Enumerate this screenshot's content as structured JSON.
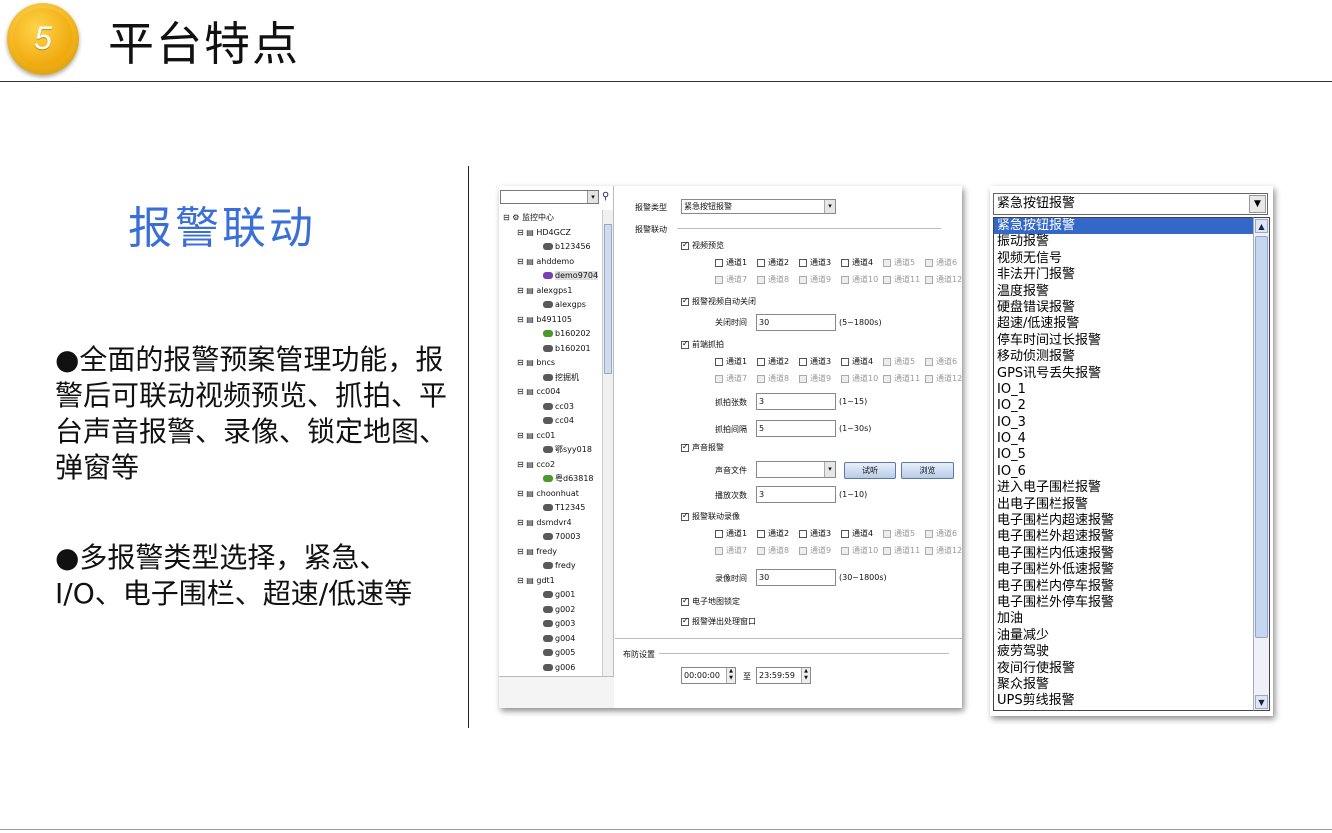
{
  "header": {
    "badge_number": "5",
    "title": "平台特点"
  },
  "section_title": "报警联动",
  "bullets": [
    "●全面的报警预案管理功能，报警后可联动视频预览、抓拍、平台声音报警、录像、锁定地图、弹窗等",
    "●多报警类型选择，紧急、I/O、电子围栏、超速/低速等"
  ],
  "tree": {
    "items": [
      {
        "label": "监控中心",
        "level": 0
      },
      {
        "label": "HD4GCZ",
        "level": 1
      },
      {
        "label": "b123456",
        "level": 2
      },
      {
        "label": "ahddemo",
        "level": 1
      },
      {
        "label": "demo9704",
        "level": 2
      },
      {
        "label": "alexgps1",
        "level": 1
      },
      {
        "label": "alexgps",
        "level": 2
      },
      {
        "label": "b491105",
        "level": 1
      },
      {
        "label": "b160202",
        "level": 2
      },
      {
        "label": "b160201",
        "level": 2
      },
      {
        "label": "bncs",
        "level": 1
      },
      {
        "label": "挖掘机",
        "level": 2
      },
      {
        "label": "cc004",
        "level": 1
      },
      {
        "label": "cc03",
        "level": 2
      },
      {
        "label": "cc04",
        "level": 2
      },
      {
        "label": "cc01",
        "level": 1
      },
      {
        "label": "鄂syy018",
        "level": 2
      },
      {
        "label": "cco2",
        "level": 1
      },
      {
        "label": "粤d63818",
        "level": 2
      },
      {
        "label": "choonhuat",
        "level": 1
      },
      {
        "label": "T12345",
        "level": 2
      },
      {
        "label": "dsmdvr4",
        "level": 1
      },
      {
        "label": "70003",
        "level": 2
      },
      {
        "label": "fredy",
        "level": 1
      },
      {
        "label": "fredy",
        "level": 2
      },
      {
        "label": "gdt1",
        "level": 1
      },
      {
        "label": "g001",
        "level": 2
      },
      {
        "label": "g002",
        "level": 2
      },
      {
        "label": "g003",
        "level": 2
      },
      {
        "label": "g004",
        "level": 2
      },
      {
        "label": "g005",
        "level": 2
      },
      {
        "label": "g006",
        "level": 2
      }
    ]
  },
  "form": {
    "alarm_type_label": "报警类型",
    "alarm_type_value": "紧急按钮报警",
    "alarm_link_label": "报警联动",
    "video_preview": "视频预览",
    "channels_row1": [
      "通道1",
      "通道2",
      "通道3",
      "通道4",
      "通道5",
      "通道6"
    ],
    "channels_row2": [
      "通道7",
      "通道8",
      "通道9",
      "通道10",
      "通道11",
      "通道12"
    ],
    "auto_close": "报警视频自动关闭",
    "close_time_label": "关闭时间",
    "close_time_value": "30",
    "close_time_range": "(5~1800s)",
    "front_capture": "前端抓拍",
    "capture_count_label": "抓拍张数",
    "capture_count_value": "3",
    "capture_count_range": "(1~15)",
    "capture_interval_label": "抓拍间隔",
    "capture_interval_value": "5",
    "capture_interval_range": "(1~30s)",
    "sound_alarm": "声音报警",
    "sound_file_label": "声音文件",
    "test_button": "试听",
    "browse_button": "浏览",
    "play_times_label": "播放次数",
    "play_times_value": "3",
    "play_times_range": "(1~10)",
    "link_record": "报警联动录像",
    "record_time_label": "录像时间",
    "record_time_value": "30",
    "record_time_range": "(30~1800s)",
    "map_lock": "电子地图锁定",
    "popup": "报警弹出处理窗口",
    "defense_label": "布防设置",
    "start_time": "00:00:00",
    "to_label": "至",
    "end_time": "23:59:59"
  },
  "dropdown": {
    "selected": "紧急按钮报警",
    "options": [
      "紧急按钮报警",
      "振动报警",
      "视频无信号",
      "非法开门报警",
      "温度报警",
      "硬盘错误报警",
      "超速/低速报警",
      "停车时间过长报警",
      "移动侦测报警",
      "GPS讯号丢失报警",
      "IO_1",
      "IO_2",
      "IO_3",
      "IO_4",
      "IO_5",
      "IO_6",
      "进入电子围栏报警",
      "出电子围栏报警",
      "电子围栏内超速报警",
      "电子围栏外超速报警",
      "电子围栏内低速报警",
      "电子围栏外低速报警",
      "电子围栏内停车报警",
      "电子围栏外停车报警",
      "加油",
      "油量减少",
      "疲劳驾驶",
      "夜间行使报警",
      "聚众报警",
      "UPS剪线报警"
    ]
  },
  "colors": {
    "accent": "#3a6fd8",
    "badge": "#f3b51d",
    "list_selected": "#3468c8"
  }
}
